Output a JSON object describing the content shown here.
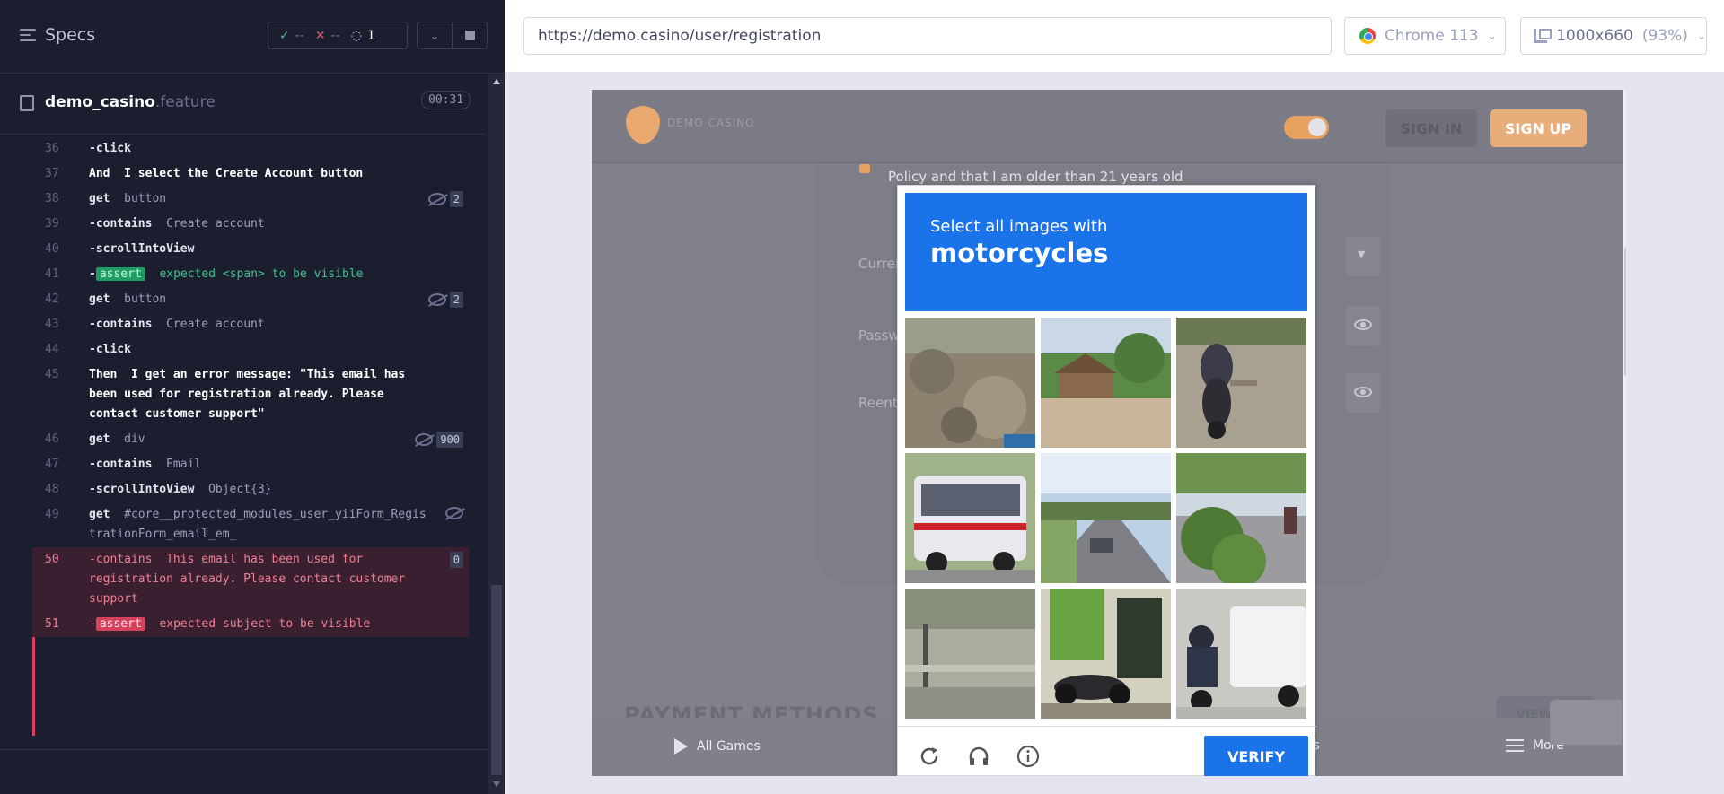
{
  "reporter": {
    "specs_label": "Specs",
    "stats": {
      "passed": "--",
      "failed": "--",
      "pending": "1"
    },
    "spec_file": {
      "name": "demo_casino",
      "ext": ".feature",
      "duration": "00:31"
    },
    "commands": [
      {
        "num": "36",
        "name": "-click",
        "message": ""
      },
      {
        "num": "37",
        "keyword": "And",
        "text": "I select the Create Account button"
      },
      {
        "num": "38",
        "name": "get",
        "message": "button",
        "count": "2"
      },
      {
        "num": "39",
        "name": "-contains",
        "message": "Create account"
      },
      {
        "num": "40",
        "name": "-scrollIntoView",
        "message": ""
      },
      {
        "num": "41",
        "name": "-",
        "badge": "assert",
        "message": "expected <span> to be visible"
      },
      {
        "num": "42",
        "name": "get",
        "message": "button",
        "count": "2"
      },
      {
        "num": "43",
        "name": "-contains",
        "message": "Create account"
      },
      {
        "num": "44",
        "name": "-click",
        "message": ""
      },
      {
        "num": "45",
        "keyword": "Then",
        "text": "I get an error message: \"This email has been used for registration already. Please contact customer support\""
      },
      {
        "num": "46",
        "name": "get",
        "message": "div",
        "count": "900"
      },
      {
        "num": "47",
        "name": "-contains",
        "message": "Email"
      },
      {
        "num": "48",
        "name": "-scrollIntoView",
        "message": "Object{3}"
      },
      {
        "num": "49",
        "name": "get",
        "message": "#core__protected_modules_user_yiiForm_RegistrationForm_email_em_"
      },
      {
        "num": "50",
        "name": "-contains",
        "message": "This email has been used for registration already. Please contact customer support",
        "count": "0"
      },
      {
        "num": "51",
        "name": "-",
        "badge": "assert",
        "message": "expected subject to be visible"
      }
    ]
  },
  "aut": {
    "url": "https://demo.casino/user/registration",
    "browser": "Chrome 113",
    "viewport": "1000x660",
    "zoom": "(93%)"
  },
  "site": {
    "logo_text": "DEMO CASINO",
    "signin": "SIGN IN",
    "signup": "SIGN UP",
    "policy_text": "Policy and that I am older than 21 years old",
    "current_label": "Curren",
    "password_label": "Passw",
    "reenter_label": "Reente",
    "payments_title": "PAYMENT METHODS",
    "view_all": "VIEW A",
    "footer": {
      "all_games": "All Games",
      "stats": "ts",
      "more": "More"
    }
  },
  "captcha": {
    "instruction": "Select all images with",
    "target": "motorcycles",
    "verify": "VERIFY",
    "accent": "#1a73e8",
    "tiles": [
      "dirt-ground",
      "roadside-village",
      "motorbike-riders",
      "white-bus",
      "highway-car",
      "roadside-shrubs",
      "shadowy-porch",
      "parked-motorcycles",
      "scooter-van"
    ]
  }
}
